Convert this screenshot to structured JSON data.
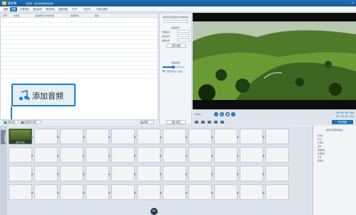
{
  "window": {
    "app_name": "爱剪辑",
    "subtitle": "最易用、强大的视频剪辑软件",
    "minimize": "–",
    "close": "×"
  },
  "menu": {
    "tabs": [
      "视频",
      "音频",
      "字幕特效",
      "叠加素材",
      "转场特效",
      "画面风格",
      "MTV",
      "卡拉OK",
      "升级与服务"
    ]
  },
  "table": {
    "headers": [
      "序号",
      "文件名",
      "在最终影片中的时间",
      "截取时长",
      "备注"
    ]
  },
  "settings": {
    "section1": "此音乐在最终影片中的时间",
    "section2": "截取音乐",
    "labels": [
      "开始时间",
      "结束时间",
      "截取时长"
    ],
    "btn_preview": "试听/截取",
    "section3": "音频音量",
    "checkbox_label": "头尾声音淡入淡出",
    "btn_confirm": "确认修改"
  },
  "add_audio": {
    "label": "添加音频"
  },
  "buttons": {
    "add_audio_small": "添加音频",
    "extract_audio": "提取原片音频",
    "delete": "删除"
  },
  "player": {
    "current_time": "00:00:00.000",
    "total_time": "02:16:03.431",
    "export": "导出视频",
    "speed": "100%"
  },
  "timeline": {
    "side_label": "已添加片段",
    "first_clip": "最大的片段"
  },
  "properties": {
    "title": "所有分辨率的信息",
    "rows": [
      "文件名:",
      "时长:",
      "分辨率:",
      "帧率:",
      "视频编码:",
      "音频编码:",
      "声道:",
      "采样率:"
    ]
  }
}
